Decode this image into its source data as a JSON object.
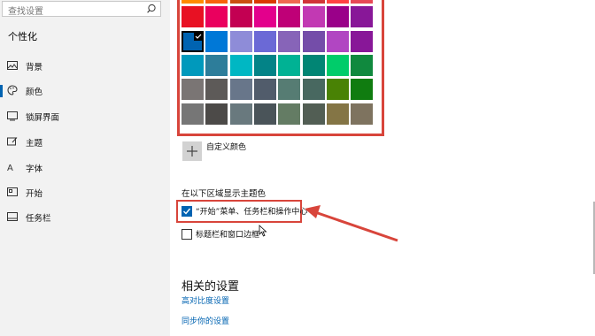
{
  "sidebar": {
    "search_placeholder": "查找设置",
    "section_title": "个性化",
    "items": [
      {
        "label": "背景",
        "icon": "picture-icon"
      },
      {
        "label": "颜色",
        "icon": "palette-icon"
      },
      {
        "label": "锁屏界面",
        "icon": "lock-screen-icon"
      },
      {
        "label": "主题",
        "icon": "theme-icon"
      },
      {
        "label": "字体",
        "icon": "font-icon"
      },
      {
        "label": "开始",
        "icon": "start-icon"
      },
      {
        "label": "任务栏",
        "icon": "taskbar-icon"
      }
    ],
    "active_item": "颜色"
  },
  "palette": {
    "rows": [
      [
        "#ff8c00",
        "#f7630c",
        "#ca5010",
        "#da3b01",
        "#ef6950",
        "#d13438",
        "#ff4343",
        "#e74856"
      ],
      [
        "#e81123",
        "#ea005e",
        "#c30052",
        "#e3008c",
        "#bf0077",
        "#c239b3",
        "#9a0089",
        "#881798"
      ],
      [
        "#0063b1",
        "#0078d7",
        "#8e8cd8",
        "#6b69d6",
        "#8764b8",
        "#744da9",
        "#b146c2",
        "#881798"
      ],
      [
        "#0099bc",
        "#2d7d9a",
        "#00b7c3",
        "#038387",
        "#00b294",
        "#018574",
        "#00cc6a",
        "#10893e"
      ],
      [
        "#7a7574",
        "#5d5a58",
        "#68768a",
        "#515c6b",
        "#567c73",
        "#486860",
        "#498205",
        "#107c10"
      ],
      [
        "#767676",
        "#4c4a48",
        "#69797e",
        "#4a5459",
        "#647c64",
        "#525e54",
        "#847545",
        "#7e735f"
      ]
    ],
    "selected_color": "#0063b1"
  },
  "custom_color_label": "自定义颜色",
  "show_accent_title": "在以下区域显示主题色",
  "options": [
    {
      "label": "“开始”菜单、任务栏和操作中心",
      "checked": true
    },
    {
      "label": "标题栏和窗口边框",
      "checked": false
    }
  ],
  "related": {
    "title": "相关的设置",
    "links": [
      "高对比度设置",
      "同步你的设置"
    ]
  },
  "colors": {
    "accent": "#0063b1",
    "highlight": "#d8453b"
  }
}
